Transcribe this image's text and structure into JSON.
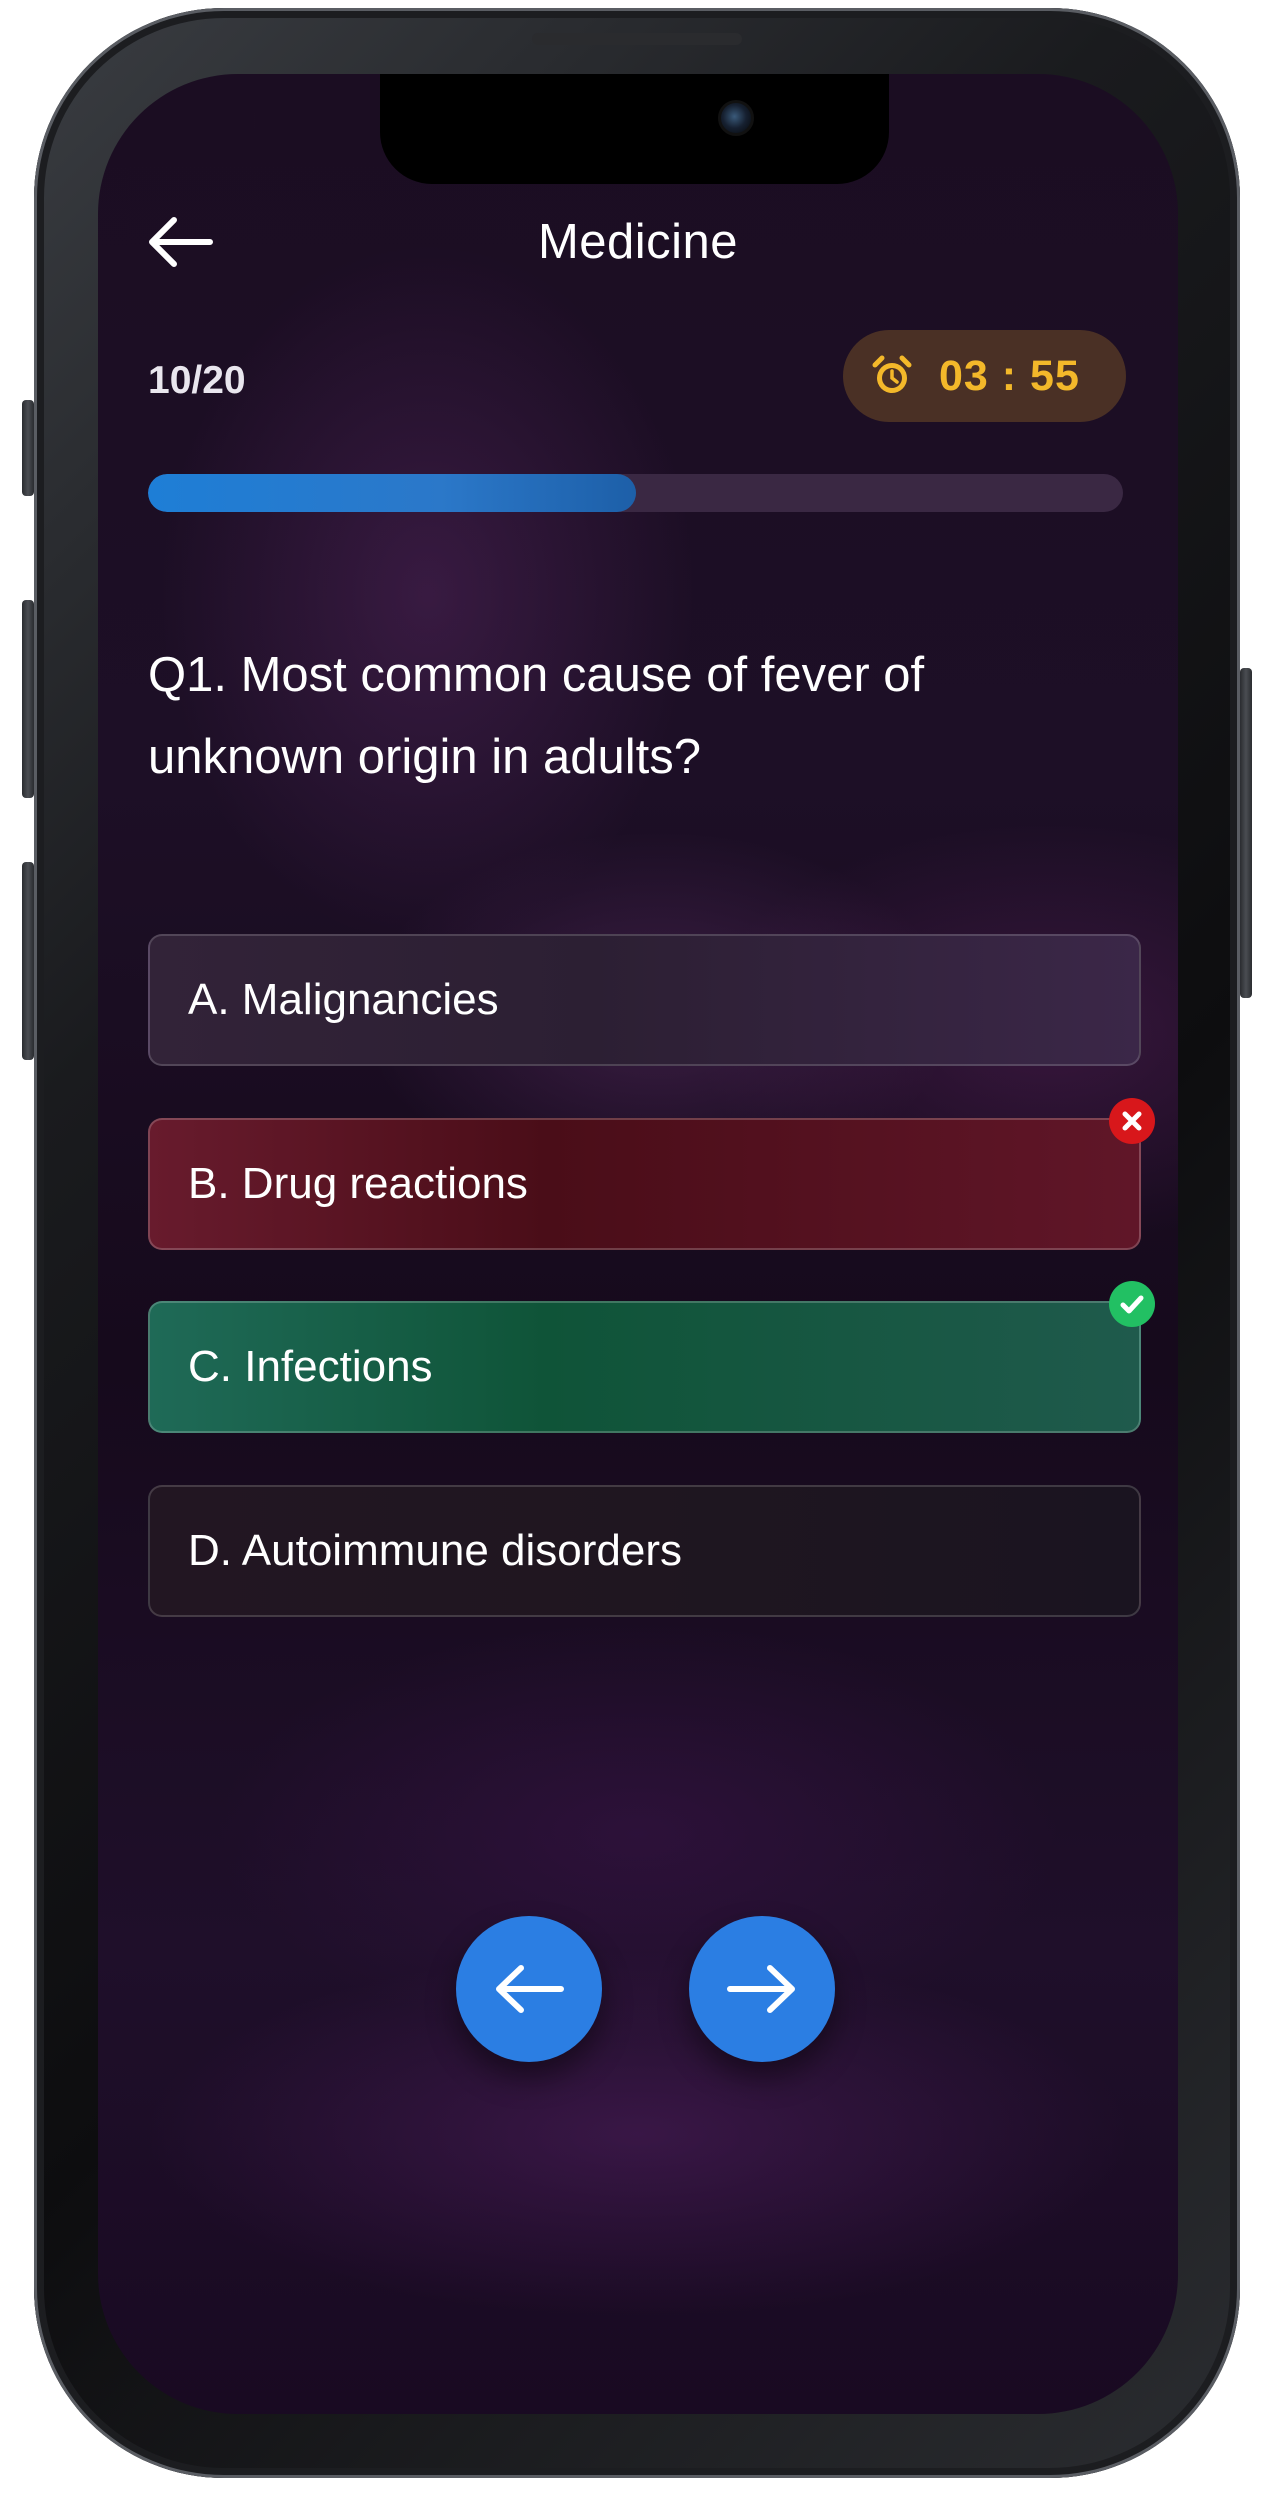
{
  "header": {
    "title": "Medicine",
    "back_icon": "arrow-left-icon"
  },
  "quiz": {
    "progress_label": "10/20",
    "progress_fraction": 0.5,
    "timer": "03 : 55",
    "timer_icon": "alarm-clock-icon",
    "question": "Q1. Most common cause of fever of unknown origin in adults?"
  },
  "options": [
    {
      "label": "A. Malignancies",
      "state": "neutral"
    },
    {
      "label": "B.  Drug reactions",
      "state": "wrong"
    },
    {
      "label": "C. Infections",
      "state": "correct"
    },
    {
      "label": "D. Autoimmune disorders",
      "state": "neutral"
    }
  ],
  "navigation": {
    "prev_icon": "arrow-left-icon",
    "next_icon": "arrow-right-icon"
  },
  "colors": {
    "accent": "#2b7ee3",
    "timer_text": "#f3b82a",
    "wrong": "#d8171b",
    "correct": "#22c063",
    "wrong_bg": "#5a1222",
    "correct_bg": "#12553f",
    "background": "#1b0d22"
  }
}
